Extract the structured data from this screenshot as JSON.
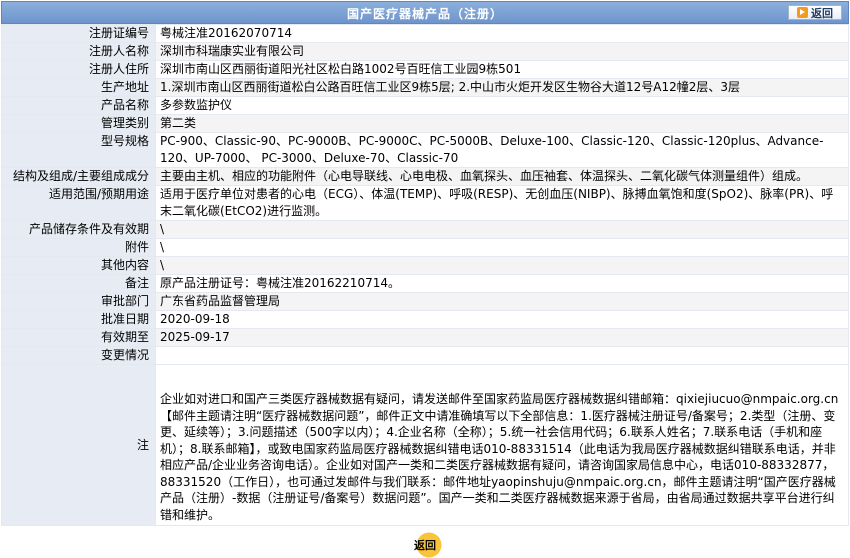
{
  "header": {
    "title": "国产医疗器械产品（注册）",
    "back_label": "返回"
  },
  "rows": [
    {
      "label": "注册证编号",
      "value": "粤械注准20162070714"
    },
    {
      "label": "注册人名称",
      "value": "深圳市科瑞康实业有限公司"
    },
    {
      "label": "注册人住所",
      "value": "深圳市南山区西丽街道阳光社区松白路1002号百旺信工业园9栋501"
    },
    {
      "label": "生产地址",
      "value": "1.深圳市南山区西丽街道松白公路百旺信工业区9栋5层; 2.中山市火炬开发区生物谷大道12号A12幢2层、3层"
    },
    {
      "label": "产品名称",
      "value": "多参数监护仪"
    },
    {
      "label": "管理类别",
      "value": "第二类"
    },
    {
      "label": "型号规格",
      "value": "PC-900、Classic-90、PC-9000B、PC-9000C、PC-5000B、Deluxe-100、Classic-120、Classic-120plus、Advance-120、UP-7000、 PC-3000、Deluxe-70、Classic-70"
    },
    {
      "label": "结构及组成/主要组成成分",
      "value": "主要由主机、相应的功能附件（心电导联线、心电电极、血氧探头、血压袖套、体温探头、二氧化碳气体测量组件）组成。"
    },
    {
      "label": "适用范围/预期用途",
      "value": "适用于医疗单位对患者的心电（ECG）、体温(TEMP)、呼吸(RESP)、无创血压(NIBP)、脉搏血氧饱和度(SpO2)、脉率(PR)、呼末二氧化碳(EtCO2)进行监测。"
    },
    {
      "label": "产品储存条件及有效期",
      "value": "\\"
    },
    {
      "label": "附件",
      "value": "\\"
    },
    {
      "label": "其他内容",
      "value": "\\"
    },
    {
      "label": "备注",
      "value": "原产品注册证号：粤械注准20162210714。"
    },
    {
      "label": "审批部门",
      "value": "广东省药品监督管理局"
    },
    {
      "label": "批准日期",
      "value": "2020-09-18"
    },
    {
      "label": "有效期至",
      "value": "2025-09-17"
    },
    {
      "label": "变更情况",
      "value": ""
    }
  ],
  "note": {
    "label": "注",
    "text": "企业如对进口和国产三类医疗器械数据有疑问，请发送邮件至国家药监局医疗器械数据纠错邮箱：qixiejiucuo@nmpaic.org.cn【邮件主题请注明“医疗器械数据问题”，邮件正文中请准确填写以下全部信息：1.医疗器械注册证号/备案号；2.类型（注册、变更、延续等）；3.问题描述（500字以内）；4.企业名称（全称）；5.统一社会信用代码；6.联系人姓名；7.联系电话（手机和座机）；8.联系邮箱】，或致电国家药监局医疗器械数据纠错电话010-88331514（此电话为我局医疗器械数据纠错联系电话，并非相应产品/企业业务咨询电话）。企业如对国产一类和二类医疗器械数据有疑问，请咨询国家局信息中心，电话010-88332877，88331520（工作日），也可通过发邮件与我们联系：邮件地址yaopinshuju@nmpaic.org.cn，邮件主题请注明“国产医疗器械产品（注册）-数据（注册证号/备案号）数据问题”。国产一类和二类医疗器械数据来源于省局，由省局通过数据共享平台进行纠错和维护。"
  },
  "footer": {
    "back_label": "返回"
  },
  "colors": {
    "header_bg": "#7ea3d6",
    "label_bg": "#e7ecf4",
    "button_accent": "#f39b1e"
  }
}
